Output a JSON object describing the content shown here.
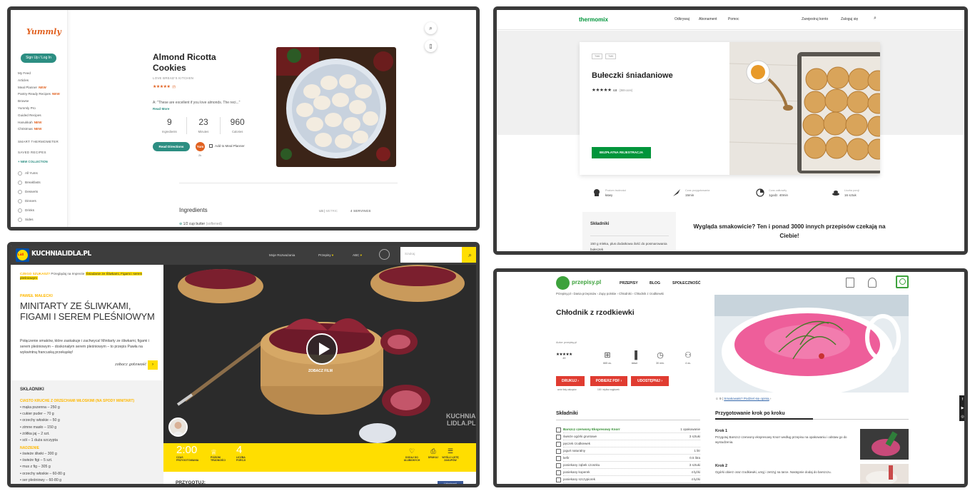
{
  "yummly": {
    "logo": "Yummly",
    "signup": "Sign Up / Log In",
    "nav": [
      {
        "label": "My Feed",
        "new": ""
      },
      {
        "label": "Articles",
        "new": ""
      },
      {
        "label": "Meal Planner",
        "new": "NEW"
      },
      {
        "label": "Pantry-Ready Recipes",
        "new": "NEW"
      },
      {
        "label": "Browse",
        "new": ""
      },
      {
        "label": "Yummly Pro",
        "new": ""
      },
      {
        "label": "Guided Recipes",
        "new": ""
      },
      {
        "label": "Hanukkah",
        "new": "NEW"
      },
      {
        "label": "Christmas",
        "new": "NEW"
      }
    ],
    "smart_thermometer": "SMART THERMOMETER",
    "saved_recipes": "SAVED RECIPES",
    "new_collection": "+ NEW COLLECTION",
    "collections": [
      "All Yums",
      "Breakfasts",
      "Desserts",
      "Dinners",
      "Drinks",
      "Sides"
    ],
    "recipe": {
      "title": "Almond Ricotta Cookies",
      "source": "LOVE BREAD'S KITCHEN",
      "stars": "★★★★★",
      "rating_count": "(7)",
      "quote": "A: \"These are excellent if you love almonds. The reci...\"",
      "read_more": "Read More",
      "stats": [
        {
          "value": "9",
          "label": "Ingredients"
        },
        {
          "value": "23",
          "label": "Minutes"
        },
        {
          "value": "960",
          "label": "Calories"
        }
      ],
      "read_directions": "Read Directions",
      "yum": "Yum",
      "yum_count": "2k",
      "add_meal_planner": "Add to Meal Planner"
    },
    "ingredients_heading": "Ingredients",
    "units": "US",
    "units_alt": "METRIC",
    "servings": "4 SERVINGS",
    "first_ingredient": "1/2 cup butter",
    "first_ingredient_note": "(softened)",
    "search_icon": "search-icon",
    "mobile_icon": "mobile-icon"
  },
  "thermomix": {
    "logo": "thermomix",
    "nav": [
      "Odkrywaj",
      "Abonament",
      "Pomoc"
    ],
    "register": "Zarejestruj konto",
    "login": "Zaloguj się",
    "tags": [
      "TM6",
      "TM5"
    ],
    "title": "Bułeczki śniadaniowe",
    "stars": "★★★★★",
    "rating": "4.8",
    "rating_count": "(369 ocen)",
    "cta": "BEZPŁATNA REJESTRACJA",
    "info": [
      {
        "label": "Poziom trudności",
        "value": "łatwy"
      },
      {
        "label": "Czas przygotowania",
        "value": "15min"
      },
      {
        "label": "Czas całkowity",
        "value": "1godz. 40min"
      },
      {
        "label": "Liczba porcji",
        "value": "16 sztuk"
      }
    ],
    "ingredients_heading": "Składniki",
    "ingredient_text": "150 g mleka, plus dodatkowa ilość do posmarowania bułeczek",
    "promo": "Wygląda smakowicie? Ten i ponad 3000 innych przepisów czekają na Ciebie!"
  },
  "lidl": {
    "brand": "KUCHNIALIDLA.PL",
    "menu": [
      "Moje Rozważania",
      "Przepisy",
      "ABC"
    ],
    "search_placeholder": "Szukaj",
    "crumb_new": "CZEGO SZUKASZ?",
    "crumb_text": "Przeglądaj na Imprezie",
    "crumb_highlight": "Śniadanie ze Śliwkami, Figami i serem pleśniowym",
    "author": "PAWEŁ MAŁECKI",
    "title": "MINITARTY ZE ŚLIWKAMI, FIGAMI I SEREM PLEŚNIOWYM",
    "description": "Połączenie smaków, które zaskakuje i zachwyca! Minitarty ze śliwkami, figami i serem pleśniowym – doskonałym serem pleśniowym – to przepis Pawła na wykwintną francuską przekąskę!",
    "zobacz": "zobacz gotowość",
    "ingredients_heading": "SKŁADNIKI",
    "section1": "CIASTO KRUCHE Z ORZECHAMI WŁOSKIMI (NA SPODY MINITART)",
    "list1": [
      "mąka pszenna – 250 g",
      "cukier puder – 70 g",
      "orzechy włoskie – 50 g",
      "zimne masło – 150 g",
      "żółtka jaj – 2 szt.",
      "sól – 1 duża szczypta"
    ],
    "section2": "NADZIENIE",
    "list2": [
      "świeże śliwki – 300 g",
      "świeże figi – 5 szt.",
      "mus z fig – 305 g",
      "orzechy włoskie – 60-80 g",
      "ser pleśniowy – 60-80 g"
    ],
    "play_label": "ZOBACZ FILM",
    "watermark_1": "KUCHNIA",
    "watermark_2": "LIDLA.PL",
    "time": "2:00",
    "time_caption": "CZAS PRZYGOTOWANIA",
    "difficulty_caption": "POZIOM TRUDNOŚCI",
    "portions": "4",
    "portions_caption": "LICZBA PORCJI",
    "actions": [
      {
        "label": "DODAJ DO ULUBIONYCH",
        "icon": "heart-icon"
      },
      {
        "label": "DRUKUJ",
        "icon": "print-icon"
      },
      {
        "label": "WYŚLIJ LISTĘ ZAKUPÓW",
        "icon": "list-icon"
      }
    ],
    "prep_heading": "PRZYGOTUJ:",
    "fb": "Udostępnij"
  },
  "przepisy": {
    "logo": "przepisy.pl",
    "menu": [
      "PRZEPISY",
      "BLOG",
      "SPOŁECZNOŚĆ"
    ],
    "crumb": "Przepisy.pl › Dania przepisów › Zupy polskie › Chłodniki › Chłodnik z rzodkiewki",
    "title": "Chłodnik z rzodkiewki",
    "author": "Autor: przepisy.pl",
    "stars": "★★★★★",
    "rating_count": "49",
    "stats": [
      {
        "icon": "calories-icon",
        "value": "665 os."
      },
      {
        "icon": "difficulty-icon",
        "value": "łatwe"
      },
      {
        "icon": "clock-icon",
        "value": "30 min."
      },
      {
        "icon": "person-icon",
        "value": "4 os."
      }
    ],
    "buttons": [
      {
        "label": "DRUKUJ ›",
        "caption": "wzór listy zakupów"
      },
      {
        "label": "POBIERZ PDF ›",
        "caption": "100 i stylisz nagłówek"
      },
      {
        "label": "UDOSTĘPNIJ ›",
        "caption": ""
      }
    ],
    "comments_count": "9",
    "comments_link": "Smakowało? Podziel się opinią",
    "ingredients_heading": "Składniki",
    "ingredients": [
      {
        "name": "Barszcz czerwony Ekspresowy Knorr",
        "qty": "1 opakowanie",
        "green": true
      },
      {
        "name": "świeże ogórki gruntowe",
        "qty": "3 sztuki",
        "green": false
      },
      {
        "name": "pęczek rzodkiewek",
        "qty": "",
        "green": false
      },
      {
        "name": "jogurt naturalny",
        "qty": "1 litr",
        "green": false
      },
      {
        "name": "kefir",
        "qty": "0.5 litra",
        "green": false
      },
      {
        "name": "posiekany ząbek czosnku",
        "qty": "3 sztuki",
        "green": false
      },
      {
        "name": "posiekany koperek",
        "qty": "4 łyżki",
        "green": false
      },
      {
        "name": "posiekany szczypiorek",
        "qty": "4 łyżki",
        "green": false
      }
    ],
    "steps_heading": "Przygotowanie krok po kroku",
    "steps": [
      {
        "title": "Krok 1",
        "text": "Przygotuj Barszcz czerwony ekspresowy Knorr według przepisu na opakowaniu i odstaw go do wystudzenia."
      },
      {
        "title": "Krok 2",
        "text": "Ogórki obierz oraz rzodkiewki, umyj i zetrzyj na tarce. Następnie dodaj do barszczu."
      }
    ]
  }
}
